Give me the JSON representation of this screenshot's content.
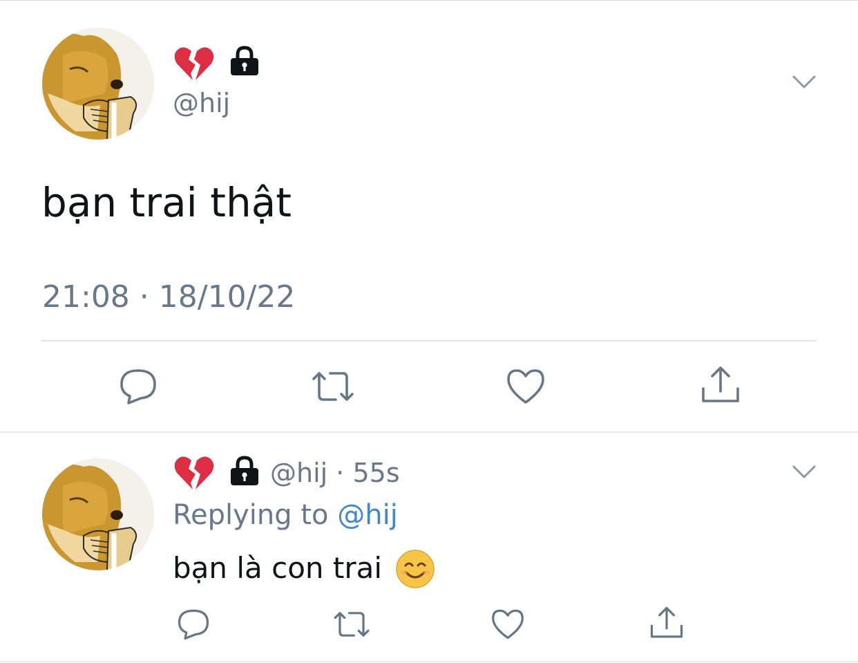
{
  "main_tweet": {
    "author_handle": "@hij",
    "text": "bạn trai thật",
    "timestamp": "21:08 · 18/10/22"
  },
  "reply": {
    "author_handle": "@hij",
    "separator": "·",
    "age": "55s",
    "replying_prefix": "Replying to",
    "replying_handle": "@hij",
    "text": "bạn là con trai"
  },
  "icons": {
    "broken_heart": "broken-heart-emoji",
    "lock": "lock-icon",
    "menu": "chevron-down-icon",
    "reply": "speech-bubble-icon",
    "retweet": "retweet-arrows-icon",
    "like": "heart-outline-icon",
    "share": "share-upload-icon",
    "smile": "smiling-face-emoji"
  },
  "colors": {
    "secondary_text": "#68778a",
    "primary_text": "#0f1419",
    "link": "#3f88cb",
    "divider": "#e2e6e9",
    "broken_heart": "#dd2e44",
    "emoji_face": "#f6c446"
  }
}
